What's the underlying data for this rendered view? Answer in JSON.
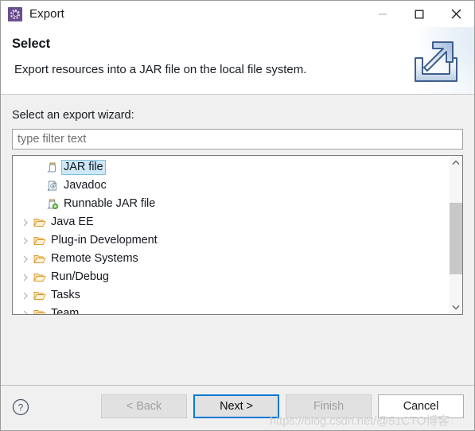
{
  "window": {
    "title": "Export",
    "app_icon": "eclipse-wizard-icon",
    "controls": {
      "minimize": "minimize-icon",
      "maximize": "maximize-icon",
      "close": "close-icon"
    }
  },
  "header": {
    "title": "Select",
    "description": "Export resources into a JAR file on the local file system.",
    "graphic": "export-arrow-icon"
  },
  "main": {
    "field_label": "Select an export wizard:",
    "filter": {
      "value": "",
      "placeholder": "type filter text"
    },
    "tree": {
      "items": [
        {
          "label": "JAR file",
          "icon": "jar-file-icon",
          "type": "leaf",
          "selected": true,
          "expandable": false
        },
        {
          "label": "Javadoc",
          "icon": "javadoc-icon",
          "type": "leaf",
          "selected": false,
          "expandable": false
        },
        {
          "label": "Runnable JAR file",
          "icon": "runnable-jar-file-icon",
          "type": "leaf",
          "selected": false,
          "expandable": false
        },
        {
          "label": "Java EE",
          "icon": "folder-icon",
          "type": "folder",
          "selected": false,
          "expandable": true
        },
        {
          "label": "Plug-in Development",
          "icon": "folder-icon",
          "type": "folder",
          "selected": false,
          "expandable": true
        },
        {
          "label": "Remote Systems",
          "icon": "folder-icon",
          "type": "folder",
          "selected": false,
          "expandable": true
        },
        {
          "label": "Run/Debug",
          "icon": "folder-icon",
          "type": "folder",
          "selected": false,
          "expandable": true
        },
        {
          "label": "Tasks",
          "icon": "folder-icon",
          "type": "folder",
          "selected": false,
          "expandable": true
        },
        {
          "label": "Team",
          "icon": "folder-icon",
          "type": "folder",
          "selected": false,
          "expandable": true
        }
      ],
      "scrollbar": {
        "up_arrow": "chevron-up-icon",
        "down_arrow": "chevron-down-icon"
      }
    }
  },
  "footer": {
    "help": "help-icon",
    "buttons": [
      {
        "label": "< Back",
        "name": "back-button",
        "state": "disabled"
      },
      {
        "label": "Next >",
        "name": "next-button",
        "state": "focused"
      },
      {
        "label": "Finish",
        "name": "finish-button",
        "state": "disabled"
      },
      {
        "label": "Cancel",
        "name": "cancel-button",
        "state": "enabled"
      }
    ]
  },
  "watermark": "https://blog.csdn.net/@51CTO博客",
  "colors": {
    "accent": "#0078d7",
    "selection": "#cde8f8",
    "selection_border": "#7fbfe0",
    "folder": "#e8a33d",
    "window_bg": "#f0f0f0",
    "app_icon": "#6b4e91"
  }
}
